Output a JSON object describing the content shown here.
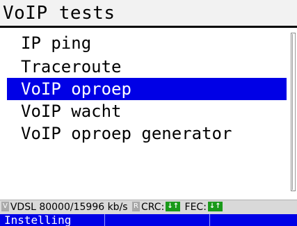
{
  "title": "VoIP tests",
  "menu": {
    "items": [
      {
        "label": "IP ping"
      },
      {
        "label": "Traceroute"
      },
      {
        "label": "VoIP oproep",
        "selected": true
      },
      {
        "label": "VoIP wacht"
      },
      {
        "label": "VoIP oproep generator"
      }
    ]
  },
  "status": {
    "mode_badge": "V",
    "link_text": "VDSL 80000/15996 kb/s",
    "r_badge": "R",
    "crc_label": "CRC:",
    "crc_icon": "↓↑",
    "fec_label": "FEC:",
    "fec_icon": "↓↑"
  },
  "softkeys": [
    {
      "label": "Instelling"
    },
    {
      "label": ""
    },
    {
      "label": ""
    }
  ],
  "colors": {
    "selection": "#0000e6",
    "softkey_bar": "#0000e6",
    "status_ok": "#1a9a1a",
    "status_bar": "#d9d9d9"
  }
}
